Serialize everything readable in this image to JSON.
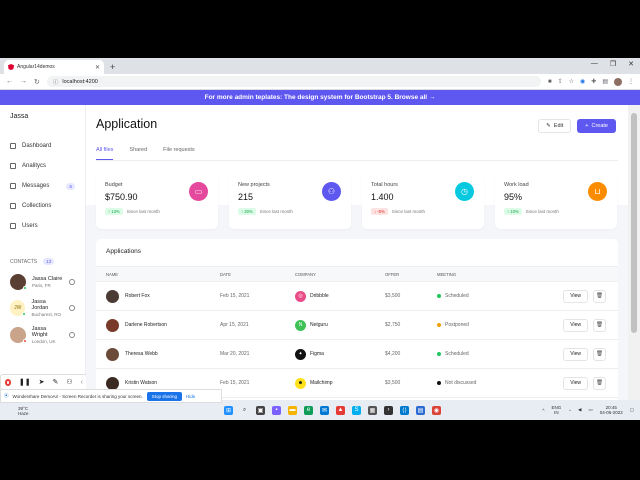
{
  "browser": {
    "tab_title": "Angular14demos",
    "new_tab": "+",
    "url": "localhost:4200",
    "window_controls": [
      "—",
      "❐",
      "✕"
    ]
  },
  "banner": {
    "text": "For more admin teplates: The design system for Bootstrap 5. Browse all →"
  },
  "sidebar": {
    "brand": "Jassa",
    "items": [
      {
        "label": "Dashboard"
      },
      {
        "label": "Analitycs"
      },
      {
        "label": "Messages",
        "badge": "6"
      },
      {
        "label": "Collections"
      },
      {
        "label": "Users"
      }
    ],
    "contacts_header": "CONTACTS",
    "contacts_count": "13",
    "contacts": [
      {
        "name": "Jassa Claire",
        "location": "Paris, FR",
        "initials": ""
      },
      {
        "name": "Jassa Jordan",
        "location": "Bucharest, RO",
        "initials": "JW"
      },
      {
        "name": "Jassa Wright",
        "location": "London, UK",
        "initials": ""
      }
    ]
  },
  "header": {
    "title": "Application",
    "edit_label": "Edit",
    "create_label": "Create"
  },
  "tabs": [
    {
      "label": "All files",
      "active": true
    },
    {
      "label": "Shared",
      "active": false
    },
    {
      "label": "File requests",
      "active": false
    }
  ],
  "stats": [
    {
      "label": "Budget",
      "value": "$750.90",
      "trend": "↑ 13%",
      "trend_dir": "up",
      "note": "Since last month",
      "color": "#e4499d",
      "icon": "credit-card-icon"
    },
    {
      "label": "New projects",
      "value": "215",
      "trend": "↑ 30%",
      "trend_dir": "up",
      "note": "Since last month",
      "color": "#5e57f0",
      "icon": "people-icon"
    },
    {
      "label": "Total hours",
      "value": "1.400",
      "trend": "↓ -5%",
      "trend_dir": "down",
      "note": "Since last month",
      "color": "#06c9e0",
      "icon": "clock-icon"
    },
    {
      "label": "Work load",
      "value": "95%",
      "trend": "↑ 10%",
      "trend_dir": "up",
      "note": "Since last month",
      "color": "#fb8c00",
      "icon": "basket-icon"
    }
  ],
  "applications": {
    "title": "Applications",
    "columns": [
      "NAME",
      "DATE",
      "COMPANY",
      "OFFER",
      "MEETING"
    ],
    "view_label": "View",
    "rows": [
      {
        "name": "Robert Fox",
        "date": "Feb 15, 2021",
        "company": "Dribbble",
        "offer": "$3,500",
        "meeting": "Scheduled",
        "status_color": "#22c55e",
        "logo_color": "#ea4c89",
        "avatar_color": "#4a3b35"
      },
      {
        "name": "Darlene Robertson",
        "date": "Apr 15, 2021",
        "company": "Netguru",
        "offer": "$2,750",
        "meeting": "Postponed",
        "status_color": "#f59e0b",
        "logo_color": "#3ec155",
        "avatar_color": "#7a3a2a"
      },
      {
        "name": "Theresa Webb",
        "date": "Mar 20, 2021",
        "company": "Figma",
        "offer": "$4,200",
        "meeting": "Scheduled",
        "status_color": "#22c55e",
        "logo_color": "#111111",
        "avatar_color": "#6b4a3a"
      },
      {
        "name": "Kristin Watson",
        "date": "Feb 15, 2021",
        "company": "Mailchimp",
        "offer": "$3,500",
        "meeting": "Not discussed",
        "status_color": "#111111",
        "logo_color": "#ffe01b",
        "avatar_color": "#3a2a22"
      }
    ]
  },
  "share_bar": {
    "text": "Wondershare DemoAir - Screen Recorder is sharing your screen.",
    "stop_label": "Stop sharing",
    "hide_label": "Hide"
  },
  "taskbar": {
    "temp": "39°C",
    "weather": "Haze",
    "lang": "ENG",
    "region": "IN",
    "time": "20:45",
    "date": "04-06-2022"
  }
}
